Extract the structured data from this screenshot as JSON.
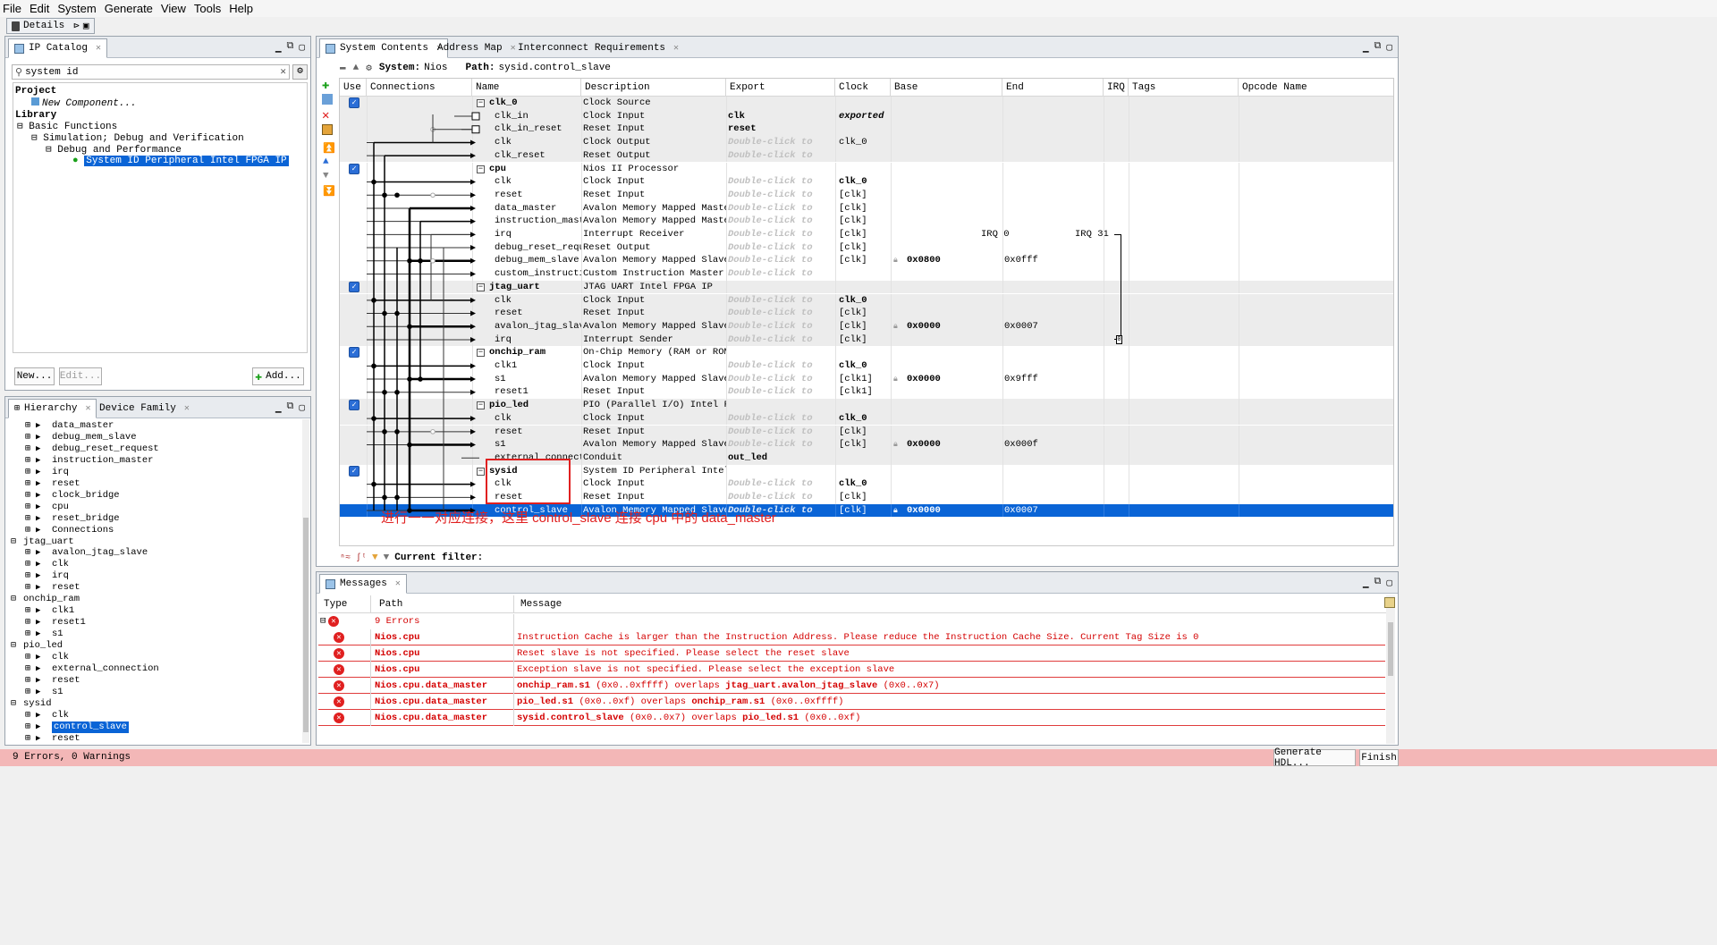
{
  "menu": [
    "File",
    "Edit",
    "System",
    "Generate",
    "View",
    "Tools",
    "Help"
  ],
  "details_tab": "Details",
  "ip_catalog": {
    "tab": "IP Catalog",
    "search_value": "system id",
    "tree": {
      "project": "Project",
      "new_component": "New Component...",
      "library": "Library",
      "basic_functions": "Basic Functions",
      "sim_debug": "Simulation; Debug and Verification",
      "debug_perf": "Debug and Performance",
      "selected": "System ID Peripheral Intel FPGA IP"
    },
    "buttons": {
      "new": "New...",
      "edit": "Edit...",
      "add": "Add..."
    }
  },
  "hierarchy": {
    "tabs": [
      "Hierarchy",
      "Device Family"
    ],
    "items": [
      {
        "label": "data_master",
        "indent": 2
      },
      {
        "label": "debug_mem_slave",
        "indent": 2
      },
      {
        "label": "debug_reset_request",
        "indent": 2
      },
      {
        "label": "instruction_master",
        "indent": 2
      },
      {
        "label": "irq",
        "indent": 2
      },
      {
        "label": "reset",
        "indent": 2
      },
      {
        "label": "clock_bridge",
        "indent": 2
      },
      {
        "label": "cpu",
        "indent": 2
      },
      {
        "label": "reset_bridge",
        "indent": 2
      },
      {
        "label": "Connections",
        "indent": 2
      },
      {
        "label": "jtag_uart",
        "indent": 1
      },
      {
        "label": "avalon_jtag_slave",
        "indent": 2
      },
      {
        "label": "clk",
        "indent": 2
      },
      {
        "label": "irq",
        "indent": 2
      },
      {
        "label": "reset",
        "indent": 2
      },
      {
        "label": "onchip_ram",
        "indent": 1
      },
      {
        "label": "clk1",
        "indent": 2
      },
      {
        "label": "reset1",
        "indent": 2
      },
      {
        "label": "s1",
        "indent": 2
      },
      {
        "label": "pio_led",
        "indent": 1
      },
      {
        "label": "clk",
        "indent": 2
      },
      {
        "label": "external_connection",
        "indent": 2
      },
      {
        "label": "reset",
        "indent": 2
      },
      {
        "label": "s1",
        "indent": 2
      },
      {
        "label": "sysid",
        "indent": 1
      },
      {
        "label": "clk",
        "indent": 2
      },
      {
        "label": "control_slave",
        "indent": 2,
        "selected": true
      },
      {
        "label": "reset",
        "indent": 2
      }
    ]
  },
  "system_contents": {
    "tabs": [
      "System Contents",
      "Address Map",
      "Interconnect Requirements"
    ],
    "system_label": "System:",
    "system_name": "Nios",
    "path_label": "Path:",
    "path_value": "sysid.control_slave",
    "columns": [
      "Use",
      "Connections",
      "Name",
      "Description",
      "Export",
      "Clock",
      "Base",
      "End",
      "IRQ",
      "Tags",
      "Opcode Name"
    ],
    "rows": [
      {
        "name": "clk_0",
        "desc": "Clock Source",
        "export": "",
        "clock": "",
        "base": "",
        "end": "",
        "top": true,
        "use": true
      },
      {
        "name": "clk_in",
        "desc": "Clock Input",
        "export": "clk",
        "clock": "exported",
        "clock_style": "bi"
      },
      {
        "name": "clk_in_reset",
        "desc": "Reset Input",
        "export": "reset",
        "clock": ""
      },
      {
        "name": "clk",
        "desc": "Clock Output",
        "export": "Double-click to",
        "clock": "clk_0"
      },
      {
        "name": "clk_reset",
        "desc": "Reset Output",
        "export": "Double-click to",
        "clock": ""
      },
      {
        "name": "cpu",
        "desc": "Nios II Processor",
        "export": "",
        "clock": "",
        "top": true,
        "use": true
      },
      {
        "name": "clk",
        "desc": "Clock Input",
        "export": "Double-click to",
        "clock": "clk_0",
        "clock_style": "b"
      },
      {
        "name": "reset",
        "desc": "Reset Input",
        "export": "Double-click to",
        "clock": "[clk]"
      },
      {
        "name": "data_master",
        "desc": "Avalon Memory Mapped Master",
        "export": "Double-click to",
        "clock": "[clk]"
      },
      {
        "name": "instruction_master",
        "desc": "Avalon Memory Mapped Master",
        "export": "Double-click to",
        "clock": "[clk]"
      },
      {
        "name": "irq",
        "desc": "Interrupt Receiver",
        "export": "Double-click to",
        "clock": "[clk]",
        "irq0": "IRQ 0",
        "irq31": "IRQ 31"
      },
      {
        "name": "debug_reset_request",
        "desc": "Reset Output",
        "export": "Double-click to",
        "clock": "[clk]"
      },
      {
        "name": "debug_mem_slave",
        "desc": "Avalon Memory Mapped Slave",
        "export": "Double-click to",
        "clock": "[clk]",
        "base": "0x0800",
        "end": "0x0fff"
      },
      {
        "name": "custom_instructi...",
        "desc": "Custom Instruction Master",
        "export": "Double-click to",
        "clock": ""
      },
      {
        "name": "jtag_uart",
        "desc": "JTAG UART Intel FPGA IP",
        "export": "",
        "clock": "",
        "top": true,
        "use": true
      },
      {
        "name": "clk",
        "desc": "Clock Input",
        "export": "Double-click to",
        "clock": "clk_0",
        "clock_style": "b"
      },
      {
        "name": "reset",
        "desc": "Reset Input",
        "export": "Double-click to",
        "clock": "[clk]"
      },
      {
        "name": "avalon_jtag_slave",
        "desc": "Avalon Memory Mapped Slave",
        "export": "Double-click to",
        "clock": "[clk]",
        "base": "0x0000",
        "end": "0x0007"
      },
      {
        "name": "irq",
        "desc": "Interrupt Sender",
        "export": "Double-click to",
        "clock": "[clk]"
      },
      {
        "name": "onchip_ram",
        "desc": "On-Chip Memory (RAM or ROM) I...",
        "export": "",
        "clock": "",
        "top": true,
        "use": true
      },
      {
        "name": "clk1",
        "desc": "Clock Input",
        "export": "Double-click to",
        "clock": "clk_0",
        "clock_style": "b"
      },
      {
        "name": "s1",
        "desc": "Avalon Memory Mapped Slave",
        "export": "Double-click to",
        "clock": "[clk1]",
        "base": "0x0000",
        "end": "0x9fff"
      },
      {
        "name": "reset1",
        "desc": "Reset Input",
        "export": "Double-click to",
        "clock": "[clk1]"
      },
      {
        "name": "pio_led",
        "desc": "PIO (Parallel I/O) Intel FPGA IP",
        "export": "",
        "clock": "",
        "top": true,
        "use": true
      },
      {
        "name": "clk",
        "desc": "Clock Input",
        "export": "Double-click to",
        "clock": "clk_0",
        "clock_style": "b"
      },
      {
        "name": "reset",
        "desc": "Reset Input",
        "export": "Double-click to",
        "clock": "[clk]"
      },
      {
        "name": "s1",
        "desc": "Avalon Memory Mapped Slave",
        "export": "Double-click to",
        "clock": "[clk]",
        "base": "0x0000",
        "end": "0x000f"
      },
      {
        "name": "external_connection",
        "desc": "Conduit",
        "export": "out_led",
        "clock": ""
      },
      {
        "name": "sysid",
        "desc": "System ID Peripheral Intel FP...",
        "export": "",
        "clock": "",
        "top": true,
        "use": true
      },
      {
        "name": "clk",
        "desc": "Clock Input",
        "export": "Double-click to",
        "clock": "clk_0",
        "clock_style": "b"
      },
      {
        "name": "reset",
        "desc": "Reset Input",
        "export": "Double-click to",
        "clock": "[clk]"
      },
      {
        "name": "control_slave",
        "desc": "Avalon Memory Mapped Slave",
        "export": "Double-click to",
        "clock": "[clk]",
        "base": "0x0000",
        "end": "0x0007",
        "selected": true
      }
    ],
    "annotation": "进行一一对应连接，这里 control_slave 连接 cpu 中的 data_master",
    "filter_label": "Current filter:"
  },
  "messages": {
    "tab": "Messages",
    "columns": [
      "Type",
      "Path",
      "Message"
    ],
    "summary": "9 Errors",
    "rows": [
      {
        "path": "Nios.cpu",
        "parts": [
          {
            "t": "Instruction Cache is larger than the Instruction Address. Please reduce the Instruction Cache Size. Current Tag Size is 0",
            "b": false
          }
        ]
      },
      {
        "path": "Nios.cpu",
        "parts": [
          {
            "t": "Reset slave is not specified. Please select the reset slave",
            "b": false
          }
        ]
      },
      {
        "path": "Nios.cpu",
        "parts": [
          {
            "t": "Exception slave is not specified. Please select the exception slave",
            "b": false
          }
        ]
      },
      {
        "path": "Nios.cpu.data_master",
        "parts": [
          {
            "t": "onchip_ram.s1",
            "b": true
          },
          {
            "t": " (0x0..0xffff) overlaps ",
            "b": false
          },
          {
            "t": "jtag_uart.avalon_jtag_slave",
            "b": true
          },
          {
            "t": " (0x0..0x7)",
            "b": false
          }
        ]
      },
      {
        "path": "Nios.cpu.data_master",
        "parts": [
          {
            "t": "pio_led.s1",
            "b": true
          },
          {
            "t": " (0x0..0xf) overlaps ",
            "b": false
          },
          {
            "t": "onchip_ram.s1",
            "b": true
          },
          {
            "t": " (0x0..0xffff)",
            "b": false
          }
        ]
      },
      {
        "path": "Nios.cpu.data_master",
        "parts": [
          {
            "t": "sysid.control_slave",
            "b": true
          },
          {
            "t": " (0x0..0x7) overlaps ",
            "b": false
          },
          {
            "t": "pio_led.s1",
            "b": true
          },
          {
            "t": " (0x0..0xf)",
            "b": false
          }
        ]
      }
    ]
  },
  "status": {
    "text": "9 Errors, 0 Warnings",
    "generate": "Generate HDL...",
    "finish": "Finish"
  },
  "colors": {
    "selection": "#0a64d6",
    "error": "#d40000",
    "status_bg": "#f3b7b7",
    "annotation": "#e02020"
  }
}
